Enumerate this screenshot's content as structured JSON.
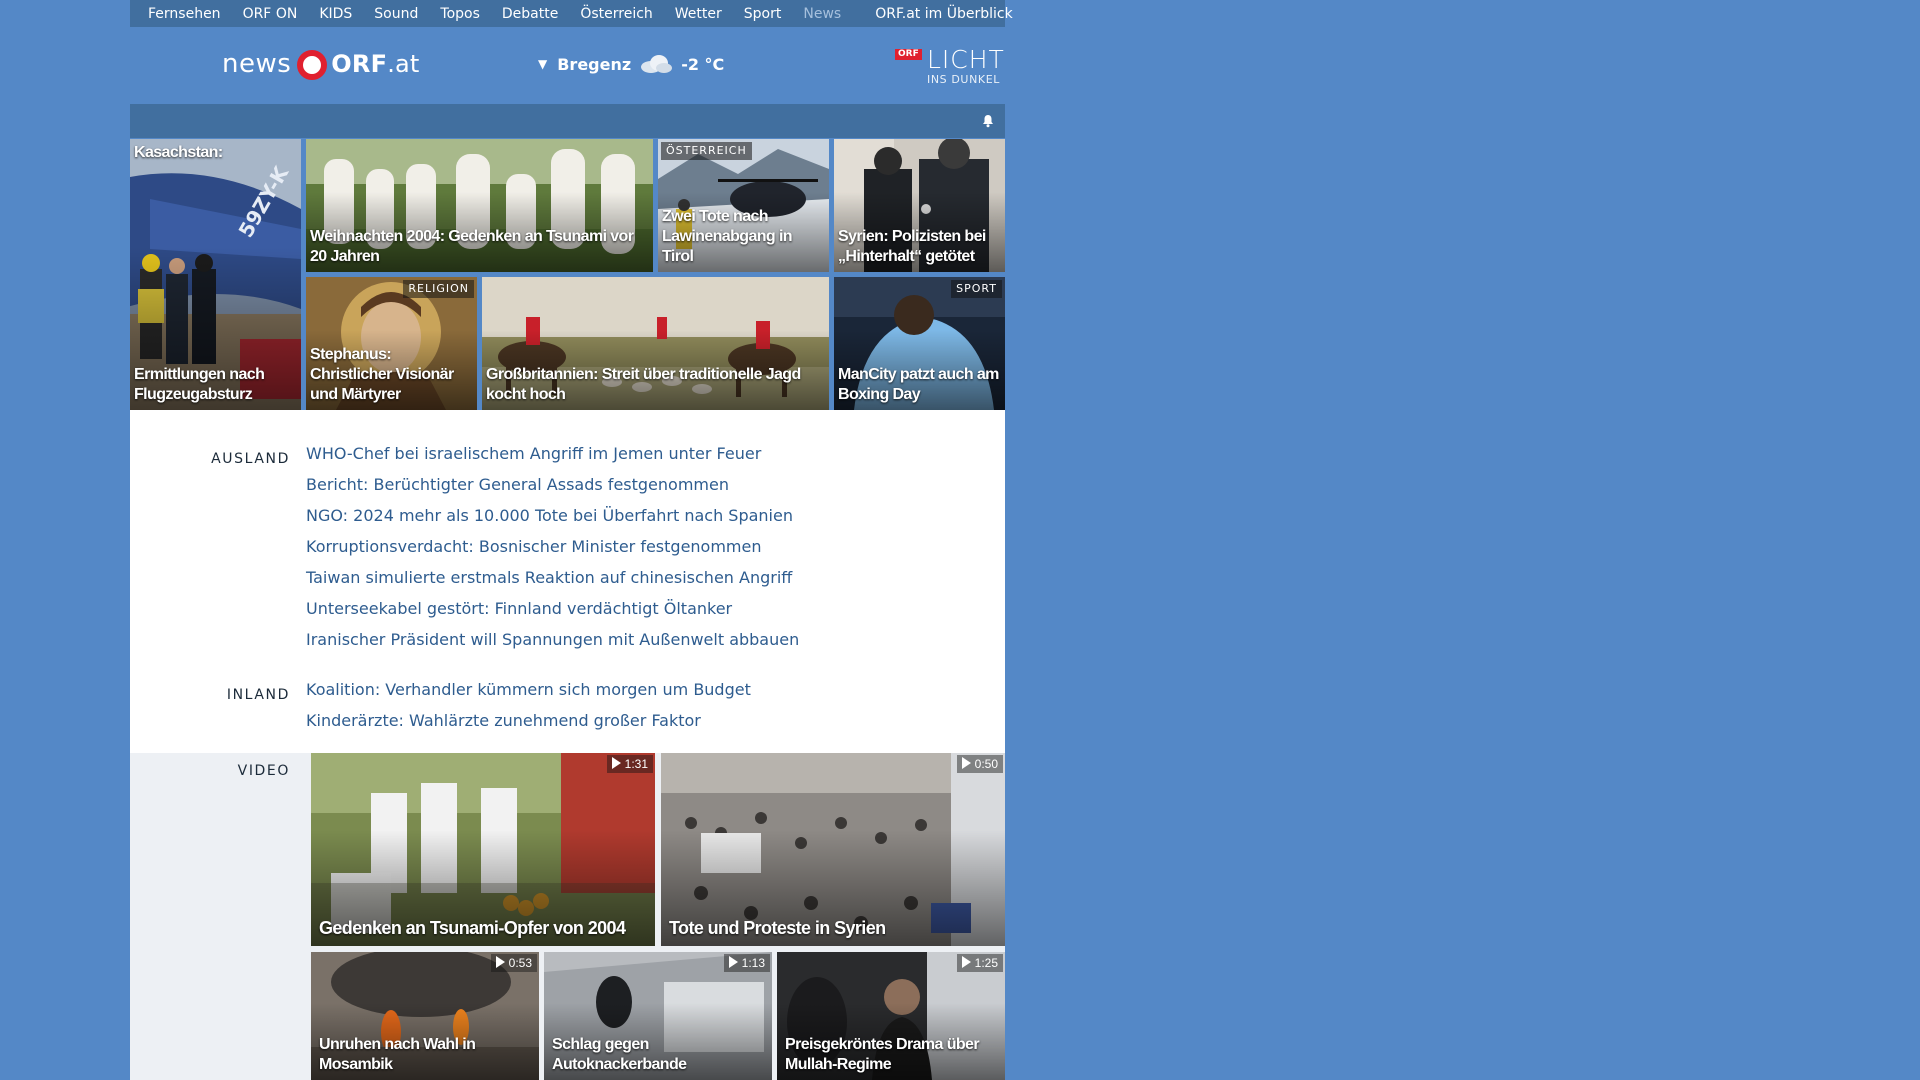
{
  "topnav": {
    "items": [
      "Fernsehen",
      "ORF ON",
      "KIDS",
      "Sound",
      "Topos",
      "Debatte",
      "Österreich",
      "Wetter",
      "Sport",
      "News"
    ],
    "active": "News",
    "overview": "ORF.at im Überblick"
  },
  "header": {
    "logo_news": "news",
    "logo_orf": "ORF",
    "logo_at": ".at",
    "weather": {
      "location": "Bregenz",
      "temp": "-2 °C",
      "icon": "cloud-icon"
    },
    "charity": {
      "badge": "ORF",
      "line1": "LICHT",
      "line2": "INS DUNKEL"
    }
  },
  "teasers": {
    "kasachstan": {
      "caption_top": "Kasachstan:",
      "caption": "Ermittlungen nach Flugzeugabsturz"
    },
    "tsunami": {
      "caption": "Weihnachten 2004: Gedenken an Tsunami vor 20 Jahren"
    },
    "tirol": {
      "tag": "ÖSTERREICH",
      "caption": "Zwei Tote nach Lawinenabgang in Tirol"
    },
    "syrien": {
      "caption": "Syrien: Polizisten bei „Hinterhalt“ getötet"
    },
    "stephanus": {
      "tag": "RELIGION",
      "caption": "Stephanus: Christlicher Visionär und Märtyrer"
    },
    "jagd": {
      "caption": "Großbritannien: Streit über traditionelle Jagd kocht hoch"
    },
    "mancity": {
      "tag": "SPORT",
      "caption": "ManCity patzt auch am Boxing Day"
    }
  },
  "sections": {
    "ausland": {
      "label": "AUSLAND",
      "links": [
        "WHO-Chef bei israelischem Angriff im Jemen unter Feuer",
        "Bericht: Berüchtigter General Assads festgenommen",
        "NGO: 2024 mehr als 10.000 Tote bei Überfahrt nach Spanien",
        "Korruptionsverdacht: Bosnischer Minister festgenommen",
        "Taiwan simulierte erstmals Reaktion auf chinesischen Angriff",
        "Unterseekabel gestört: Finnland verdächtigt Öltanker",
        "Iranischer Präsident will Spannungen mit Außenwelt abbauen"
      ]
    },
    "inland": {
      "label": "INLAND",
      "links": [
        "Koalition: Verhandler kümmern sich morgen um Budget",
        "Kinderärzte: Wahlärzte zunehmend großer Faktor"
      ]
    }
  },
  "video": {
    "label": "VIDEO",
    "items": [
      {
        "duration": "1:31",
        "caption": "Gedenken an Tsunami-Opfer von 2004"
      },
      {
        "duration": "0:50",
        "caption": "Tote und Proteste in Syrien"
      },
      {
        "duration": "0:53",
        "caption": "Unruhen nach Wahl in Mosambik"
      },
      {
        "duration": "1:13",
        "caption": "Schlag gegen Autoknackerbande"
      },
      {
        "duration": "1:25",
        "caption": "Preisgekröntes Drama über Mullah-Regime"
      }
    ]
  }
}
